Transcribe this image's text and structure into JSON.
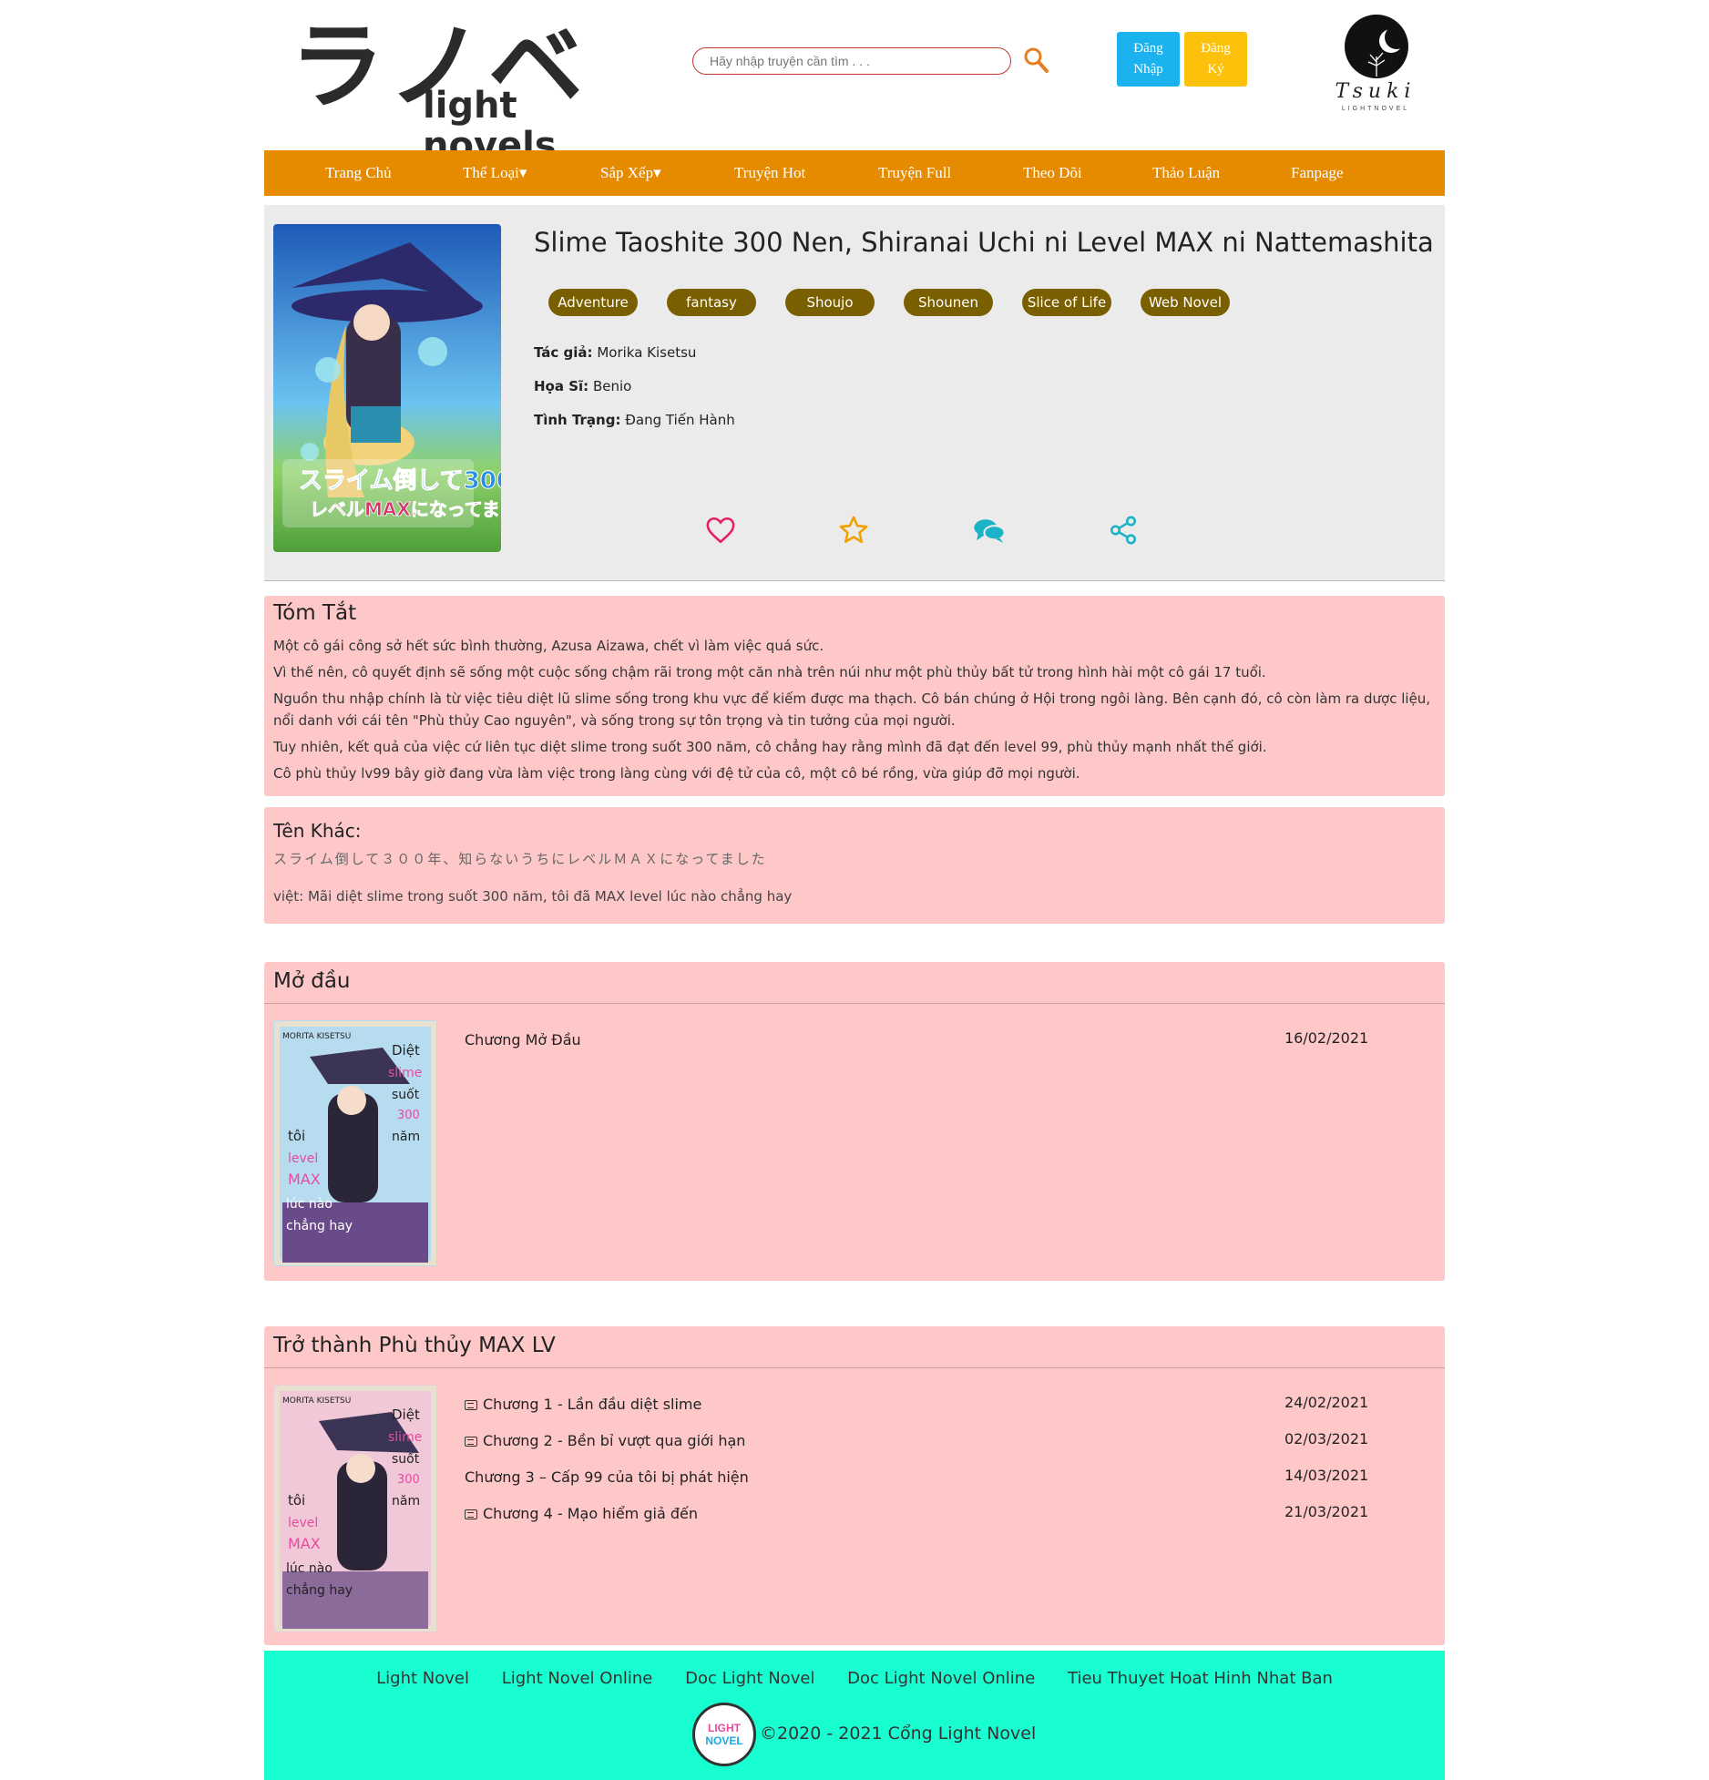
{
  "header": {
    "logo_jp": "ラノベ",
    "logo_en": "light novels",
    "search_placeholder": "Hãy nhập truyện cần tìm . . .",
    "login_line1": "Đăng",
    "login_line2": "Nhập",
    "register_line1": "Đăng",
    "register_line2": "Ký",
    "brand_name": "Tsuki",
    "brand_sub": "LIGHTNOVEL"
  },
  "nav": [
    {
      "label": "Trang Chủ"
    },
    {
      "label": "Thể Loại▾"
    },
    {
      "label": "Sắp Xếp▾"
    },
    {
      "label": "Truyện Hot"
    },
    {
      "label": "Truyện Full"
    },
    {
      "label": "Theo Dõi"
    },
    {
      "label": "Thảo Luận"
    },
    {
      "label": "Fanpage"
    }
  ],
  "novel": {
    "title": "Slime Taoshite 300 Nen, Shiranai Uchi ni Level MAX ni Nattemashita",
    "tags": [
      "Adventure",
      "fantasy",
      "Shoujo",
      "Shounen",
      "Slice of Life",
      "Web Novel"
    ],
    "author_label": "Tác giả:",
    "author": "Morika Kisetsu",
    "artist_label": "Họa Sĩ:",
    "artist": "Benio",
    "status_label": "Tình Trạng:",
    "status": "Đang Tiến Hành"
  },
  "summary": {
    "heading": "Tóm Tắt",
    "paragraphs": [
      "Một cô gái công sở hết sức bình thường, Azusa Aizawa, chết vì làm việc quá sức.",
      "Vì thế nên, cô quyết định sẽ sống một cuộc sống chậm rãi trong một căn nhà trên núi như một phù thủy bất tử trong hình hài một cô gái 17 tuổi.",
      "Nguồn thu nhập chính là từ việc tiêu diệt lũ slime sống trong khu vực để kiếm được ma thạch. Cô bán chúng ở Hội trong ngôi làng. Bên cạnh đó, cô còn làm ra dược liệu, nổi danh với cái tên \"Phù thủy Cao nguyên\", và sống trong sự tôn trọng và tin tưởng của mọi người.",
      "Tuy nhiên, kết quả của việc cứ liên tục diệt slime trong suốt 300 năm, cô chẳng hay rằng mình đã đạt đến level 99, phù thủy mạnh nhất thế giới.",
      "Cô phù thủy lv99 bây giờ đang vừa làm việc trong làng cùng với đệ tử của cô, một cô bé rồng, vừa giúp đỡ mọi người."
    ]
  },
  "other_names": {
    "heading": "Tên Khác:",
    "jp": "スライム倒して３００年、知らないうちにレベルＭＡＸになってました",
    "vi": "việt: Mãi diệt slime trong suốt 300 năm, tôi đã MAX level lúc nào chẳng hay"
  },
  "volumes": [
    {
      "title": "Mở đầu",
      "chapters": [
        {
          "title": "Chương Mở Đầu",
          "date": "16/02/2021",
          "icon": false
        }
      ]
    },
    {
      "title": "Trở thành Phù thủy MAX LV",
      "chapters": [
        {
          "title": "Chương 1 - Lần đầu diệt slime",
          "date": "24/02/2021",
          "icon": true
        },
        {
          "title": "Chương 2 - Bền bỉ vượt qua giới hạn",
          "date": "02/03/2021",
          "icon": true
        },
        {
          "title": "Chương 3 – Cấp 99 của tôi bị phát hiện",
          "date": "14/03/2021",
          "icon": false
        },
        {
          "title": "Chương 4 - Mạo hiểm giả đến",
          "date": "21/03/2021",
          "icon": true
        }
      ]
    }
  ],
  "cover_text": {
    "vol_author": "MORITA KISETSU",
    "vol_lines": [
      "Diệt",
      "slime",
      "suốt",
      "300",
      "năm",
      "tôi",
      "level",
      "MAX",
      "lúc nào",
      "chẳng hay"
    ]
  },
  "footer": {
    "links": [
      "Light Novel",
      "Light Novel Online",
      "Doc Light Novel",
      "Doc Light Novel Online",
      "Tieu Thuyet Hoat Hinh Nhat Ban"
    ],
    "badge_line1": "LIGHT",
    "badge_line2": "NOVEL",
    "copyright": "©2020 - 2021 Cổng Light Novel"
  },
  "colors": {
    "nav": "#e68a00",
    "tag": "#7a5f00",
    "panel": "#fec8c9",
    "footer": "#19fed1",
    "login": "#1ab2ef",
    "register": "#fcc10a"
  }
}
